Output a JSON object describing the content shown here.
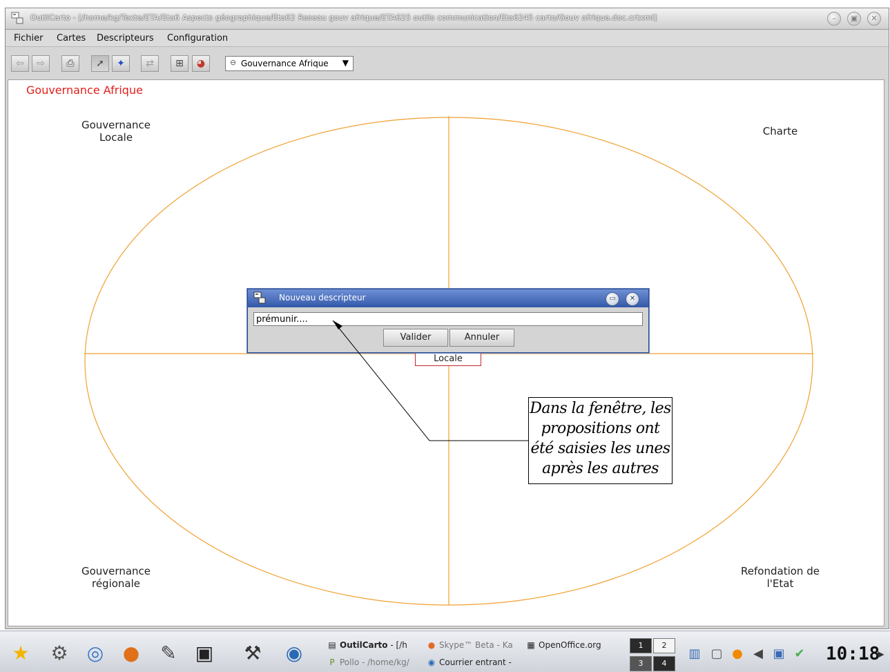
{
  "window": {
    "title": "OutilCarto - [/home/kg/Texte/ETA/Eta6 Aspects géographique/Eta62 Reseau gouv afrique/ETA625 outils communication/Eta6245 carto/Gouv afrique.doc.crtxml]",
    "controls": [
      "minimize",
      "maximize",
      "close"
    ]
  },
  "menu": {
    "fichier": "Fichier",
    "cartes": "Cartes",
    "descripteurs": "Descripteurs",
    "configuration": "Configuration"
  },
  "toolbar": {
    "map_select_value": "Gouvernance Afrique",
    "icons": [
      "back-arrow",
      "forward-arrow",
      "printer",
      "select-pointer",
      "add-descriptor",
      "swap",
      "add-node",
      "color-wheel"
    ]
  },
  "canvas": {
    "map_title": "Gouvernance Afrique",
    "map_title_color": "#e0201c",
    "axis_color": "#f0a030",
    "quadrants": {
      "top_left": [
        "Gouvernance",
        "Locale"
      ],
      "top_right": [
        "Charte"
      ],
      "bottom_left": [
        "Gouvernance",
        "régionale"
      ],
      "bottom_right": [
        "Refondation de",
        "l'Etat"
      ]
    },
    "center_node": "Locale"
  },
  "dialog": {
    "title": "Nouveau descripteur",
    "input_value": "prémunir....",
    "valider": "Valider",
    "annuler": "Annuler"
  },
  "callout": {
    "lines": [
      "Dans la fenêtre, les",
      "propositions ont",
      "été saisies les unes",
      "après les autres"
    ]
  },
  "taskbar": {
    "tasks": {
      "outilcarto_bold": "OutilCarto",
      "outilcarto_rest": " - [/h",
      "skype": "Skype™ Beta - Ka",
      "openoffice": "OpenOffice.org",
      "pollo": "Pollo - /home/kg/",
      "courrier": "Courrier entrant -"
    },
    "pager": [
      "1",
      "2",
      "3",
      "4"
    ],
    "clock": "10:18"
  }
}
